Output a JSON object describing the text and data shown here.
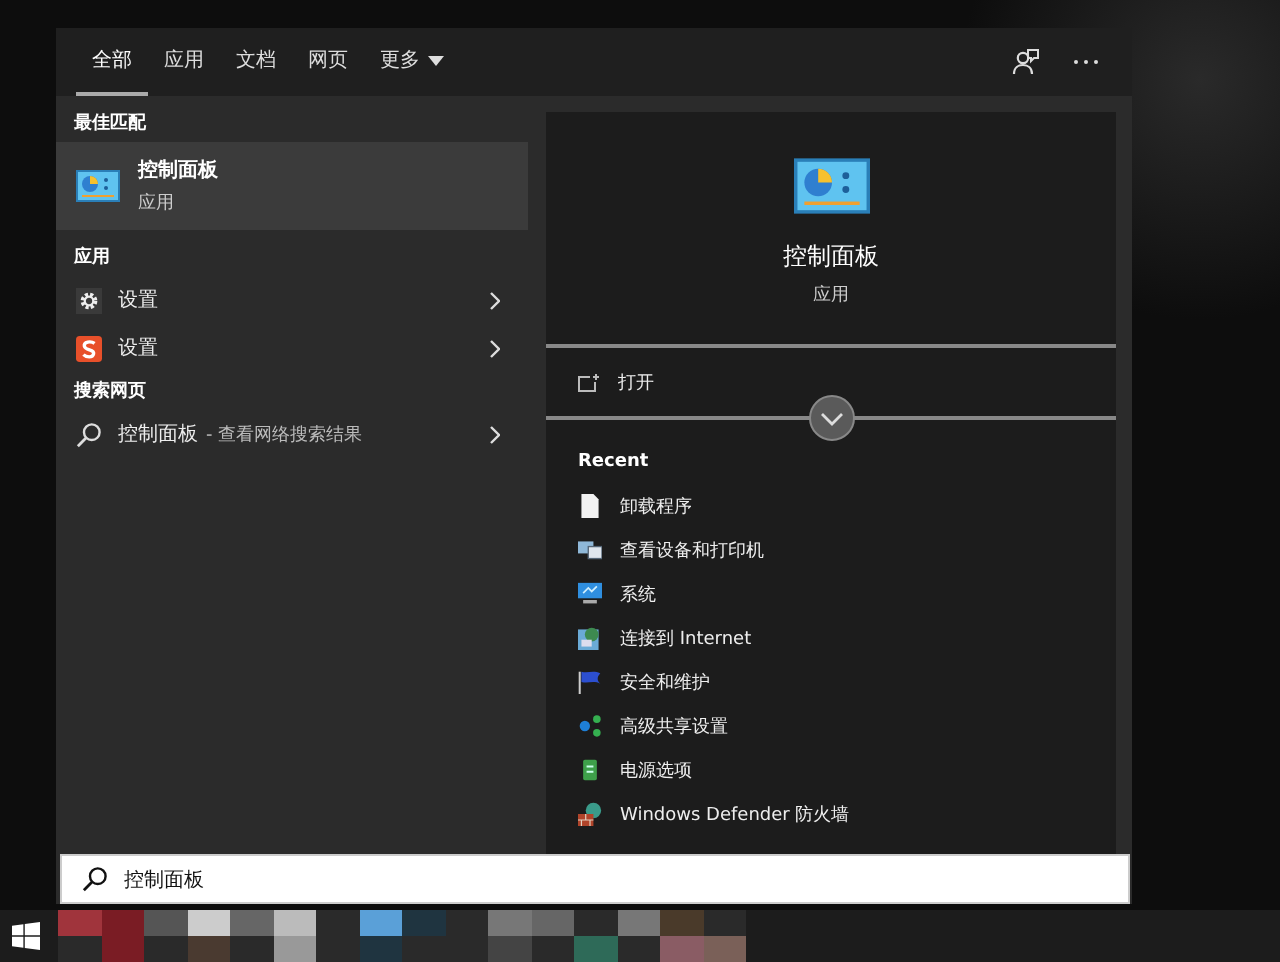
{
  "tabs": [
    {
      "label": "全部",
      "selected": true,
      "kind": "plain"
    },
    {
      "label": "应用",
      "selected": false,
      "kind": "plain"
    },
    {
      "label": "文档",
      "selected": false,
      "kind": "plain"
    },
    {
      "label": "网页",
      "selected": false,
      "kind": "plain"
    },
    {
      "label": "更多",
      "selected": false,
      "kind": "menu"
    }
  ],
  "sections": [
    {
      "heading": "最佳匹配",
      "items": [
        {
          "kind": "best",
          "title": "控制面板",
          "subtitle": "应用",
          "selected": true
        }
      ]
    },
    {
      "heading": "应用",
      "items": [
        {
          "kind": "app",
          "title": "设置",
          "selected": false
        },
        {
          "kind": "app",
          "title": "设置",
          "selected": false
        }
      ]
    },
    {
      "heading": "搜索网页",
      "items": [
        {
          "kind": "web",
          "title": "控制面板",
          "detail": "- 查看网络搜索结果",
          "selected": false
        }
      ]
    }
  ],
  "preview": {
    "title": "控制面板",
    "subtitle": "应用"
  },
  "actions": [
    {
      "label": "打开"
    }
  ],
  "recent": {
    "heading": "Recent",
    "items": [
      {
        "label": "卸载程序"
      },
      {
        "label": "查看设备和打印机"
      },
      {
        "label": "系统"
      },
      {
        "label": "连接到 Internet"
      },
      {
        "label": "安全和维护"
      },
      {
        "label": "高级共享设置"
      },
      {
        "label": "电源选项"
      },
      {
        "label": "Windows Defender 防火墙"
      }
    ]
  },
  "search": {
    "value": "控制面板"
  }
}
